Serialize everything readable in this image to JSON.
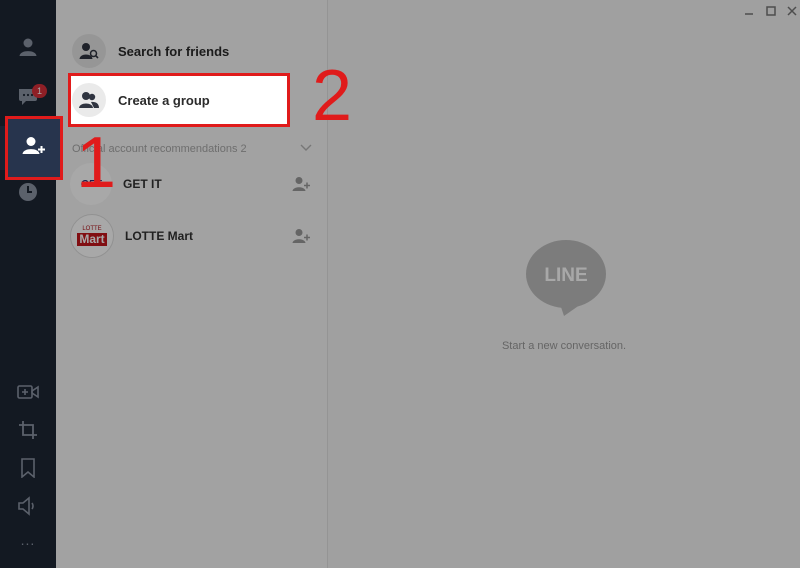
{
  "colors": {
    "rail_bg": "#1e2635",
    "rail_active": "#27344d",
    "highlight_red": "#e01b1b",
    "badge_red": "#d8303b"
  },
  "rail": {
    "items": [
      {
        "name": "friends",
        "icon": "person-icon"
      },
      {
        "name": "chats",
        "icon": "chat-bubble-icon",
        "badge": "1"
      },
      {
        "name": "add-friend",
        "icon": "add-friend-icon",
        "active": true
      },
      {
        "name": "history",
        "icon": "clock-icon"
      }
    ],
    "bottom": [
      {
        "name": "video",
        "icon": "video-call-icon"
      },
      {
        "name": "crop",
        "icon": "crop-icon"
      },
      {
        "name": "keep",
        "icon": "bookmark-icon"
      },
      {
        "name": "sound",
        "icon": "speaker-icon"
      },
      {
        "name": "more",
        "icon": "more-icon",
        "label": "..."
      }
    ]
  },
  "panel": {
    "search_friends_label": "Search for friends",
    "create_group_label": "Create a group",
    "section_label": "Official account recommendations 2",
    "accounts": [
      {
        "name": "GET IT",
        "logo_text": "GET"
      },
      {
        "name": "LOTTE Mart",
        "logo_text_top": "LOTTE",
        "logo_text_bottom": "Mart"
      }
    ]
  },
  "annotations": {
    "step1": "1",
    "step2": "2"
  },
  "chat": {
    "logo_text": "LINE",
    "placeholder": "Start a new conversation."
  }
}
